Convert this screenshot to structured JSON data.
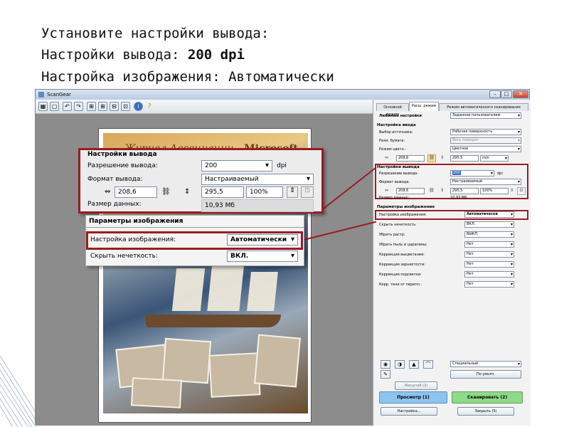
{
  "heading": {
    "line1": "Установите настройки вывода:",
    "line2_prefix": "Настройки вывода: ",
    "line2_value": "200 dpi",
    "line3": "Настройка изображения: Автоматически"
  },
  "window": {
    "title": "ScanGear",
    "buttons": {
      "minimize": "–",
      "maximize": "□",
      "close": "✕"
    }
  },
  "preview": {
    "magazine_title_left": "Журнал Ассоциации",
    "magazine_title_right": "Microsoft",
    "checkbox_mark": "✓",
    "checkbox_num": "1"
  },
  "tabs": [
    "Основной режим",
    "Расш. режим",
    "Режим автоматического сканирования"
  ],
  "favorites": {
    "label": "Любимые настройки",
    "value": "Заданное пользователем"
  },
  "input": {
    "section": "Настройка ввода",
    "source_label": "Выбор источника:",
    "source_value": "Рабочая поверхность",
    "paper_label": "Разм. бумаги:",
    "paper_value": "Весь планшет",
    "color_label": "Режим цветн.:",
    "color_value": "Цветное",
    "width": "208,6",
    "height": "295,5",
    "unit": "mm"
  },
  "output": {
    "section": "Настройки вывода",
    "res_label": "Разрешение вывода:",
    "res_value": "200",
    "res_unit": "dpi",
    "format_label": "Формат вывода:",
    "format_value": "Настраиваемый",
    "width": "208,6",
    "height": "295,5",
    "scale": "100%",
    "size_label": "Размер данных:",
    "size_value": "10,93 Мб"
  },
  "image": {
    "section": "Параметры изображения",
    "rows": [
      {
        "label": "Настройка изображения:",
        "value": "Автоматически"
      },
      {
        "label": "Скрыть нечеткость:",
        "value": "ВКЛ."
      },
      {
        "label": "Убрать растр:",
        "value": "ВЫКЛ."
      },
      {
        "label": "Убрать пыль и царапины:",
        "value": "Нет"
      },
      {
        "label": "Коррекция выцветания:",
        "value": "Нет"
      },
      {
        "label": "Коррекция зернистости:",
        "value": "Нет"
      },
      {
        "label": "Коррекция подсветки:",
        "value": "Нет"
      },
      {
        "label": "Корр. тени от перепл.:",
        "value": "Нет"
      }
    ]
  },
  "bottom": {
    "tone_select": "Специальный",
    "defaults_button": "По умолч.",
    "zoom_button": "Масштаб (3)",
    "preview_button": "Просмотр (1)",
    "scan_button": "Сканировать (2)",
    "settings_button": "Настройка...",
    "close_button": "Закрыть (5)"
  },
  "colors": {
    "highlight": "#9a1c24",
    "preview_btn": "#8cc4f0",
    "scan_btn": "#8fd98a"
  }
}
